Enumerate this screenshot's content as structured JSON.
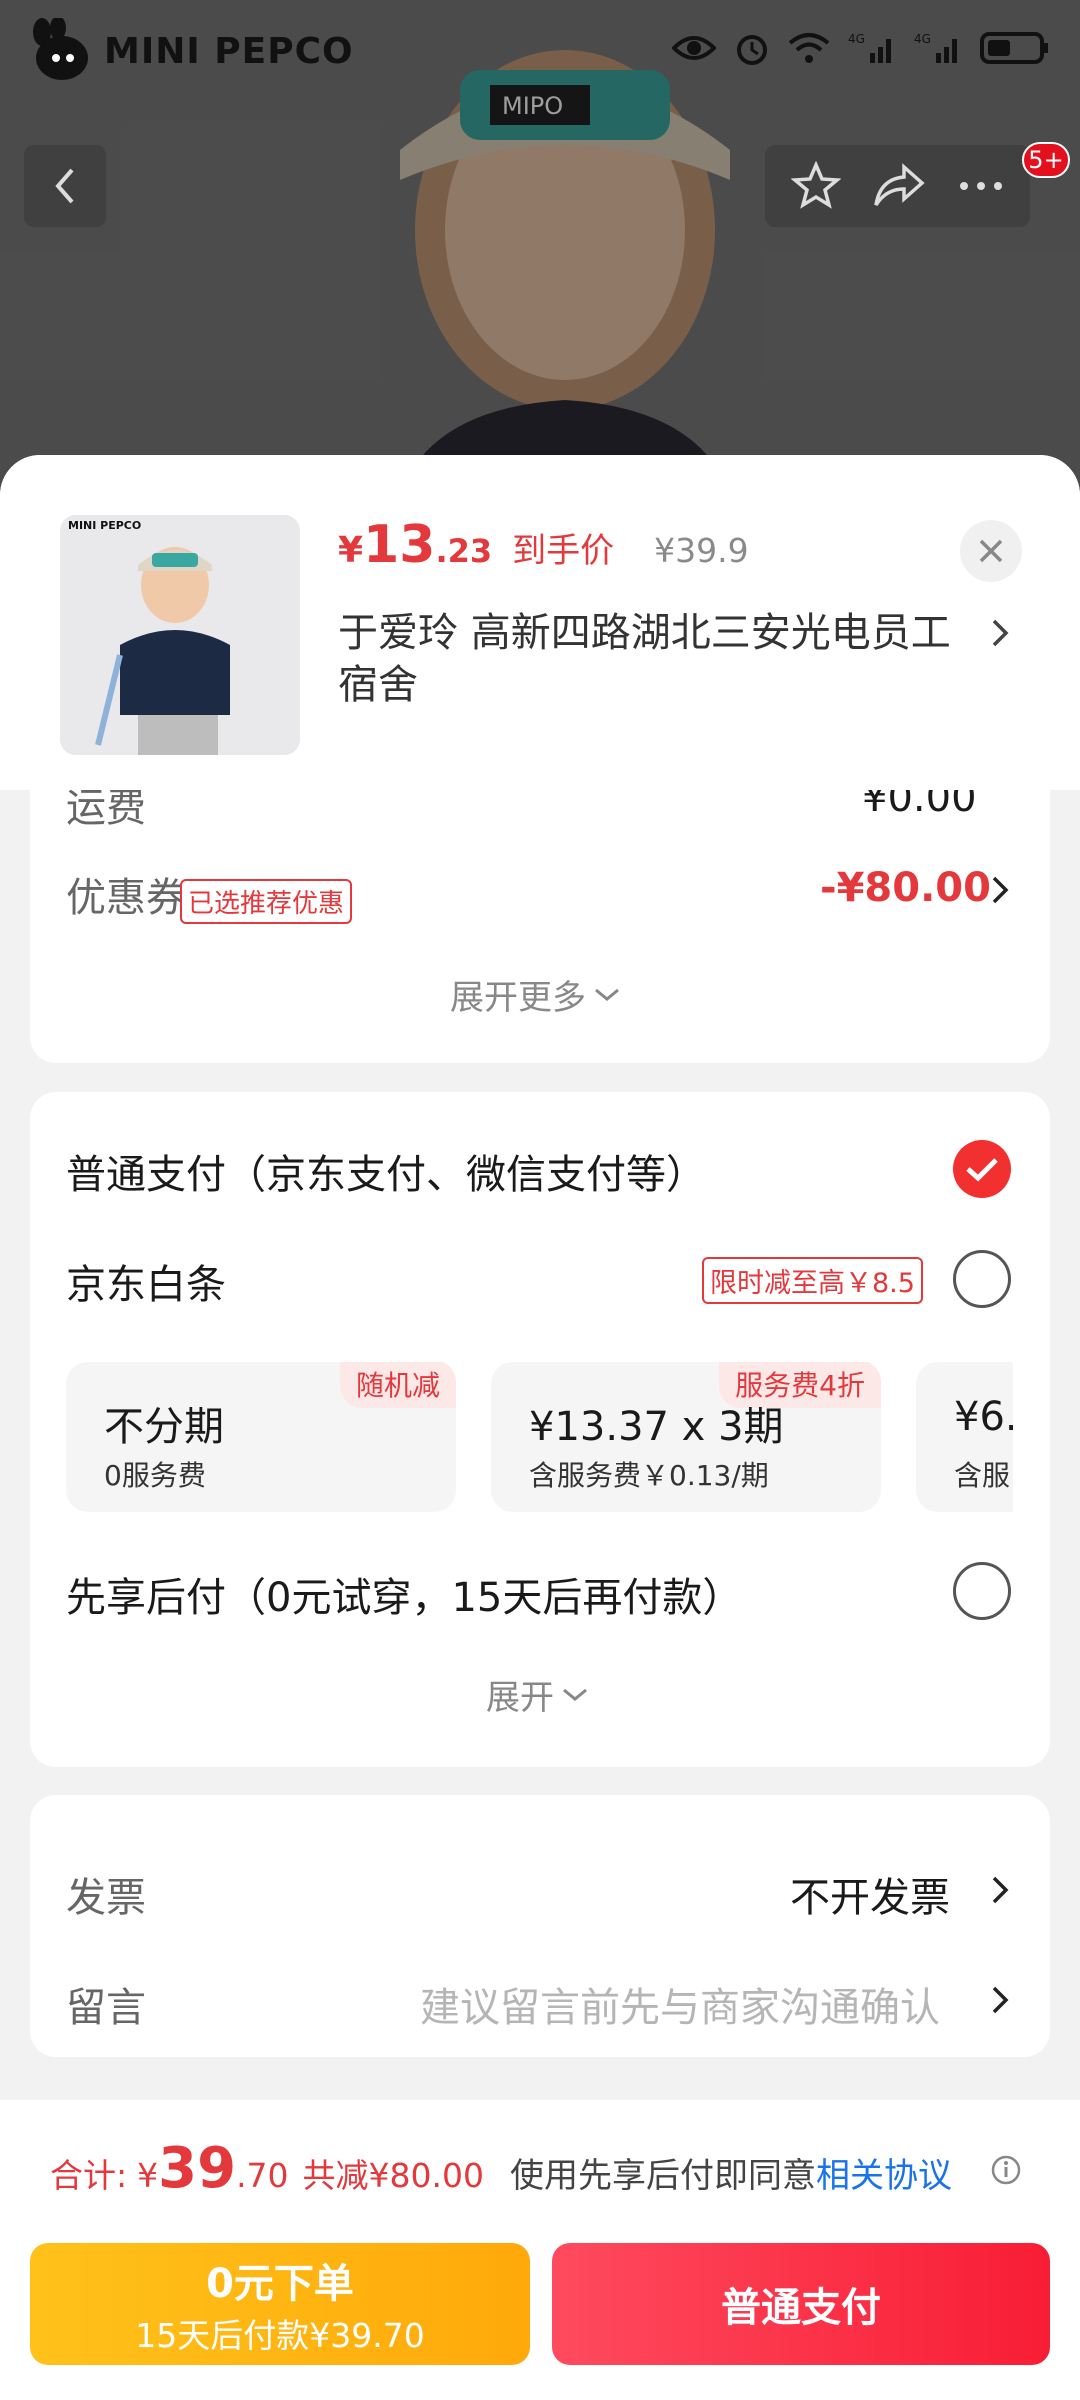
{
  "status_bar": {
    "brand": "MINI PEPCO"
  },
  "header": {
    "badge_count": "5+"
  },
  "product": {
    "currency": "¥",
    "price_int": "13",
    "price_dec": ".23",
    "price_tag": "到手价",
    "original_price": "¥39.9",
    "address": "于爱玲  高新四路湖北三安光电员工宿舍"
  },
  "order": {
    "shipping_label": "运费",
    "shipping_value": "¥0.00",
    "coupon_label": "优惠券",
    "coupon_tag": "已选推荐优惠",
    "coupon_value": "-¥80.00",
    "expand_more": "展开更多"
  },
  "payment": {
    "normal_label": "普通支付（京东支付、微信支付等）",
    "baitiao_label": "京东白条",
    "baitiao_tag": "限时减至高￥8.5",
    "plans": [
      {
        "tag": "随机减",
        "main": "不分期",
        "sub": "0服务费"
      },
      {
        "tag": "服务费4折",
        "main": "¥13.37 x 3期",
        "sub": "含服务费￥0.13/期"
      },
      {
        "tag": "",
        "main": "¥6.",
        "sub": "含服"
      }
    ],
    "later_label": "先享后付（0元试穿，15天后再付款）",
    "expand": "展开"
  },
  "extras": {
    "invoice_label": "发票",
    "invoice_value": "不开发票",
    "message_label": "留言",
    "message_placeholder": "建议留言前先与商家沟通确认"
  },
  "total": {
    "label": "合计:",
    "currency": "¥",
    "int": "39",
    "dec": ".70",
    "saved": "共减¥80.00",
    "agree_text": "使用先享后付即同意",
    "agree_link": "相关协议"
  },
  "buttons": {
    "zero_main": "0元下单",
    "zero_sub": "15天后付款¥39.70",
    "normal": "普通支付"
  },
  "colors": {
    "accent": "#e4393c",
    "check": "#f23030",
    "yellow": "#ffb412",
    "red_button": "#f8283f",
    "link": "#1a73e8"
  }
}
